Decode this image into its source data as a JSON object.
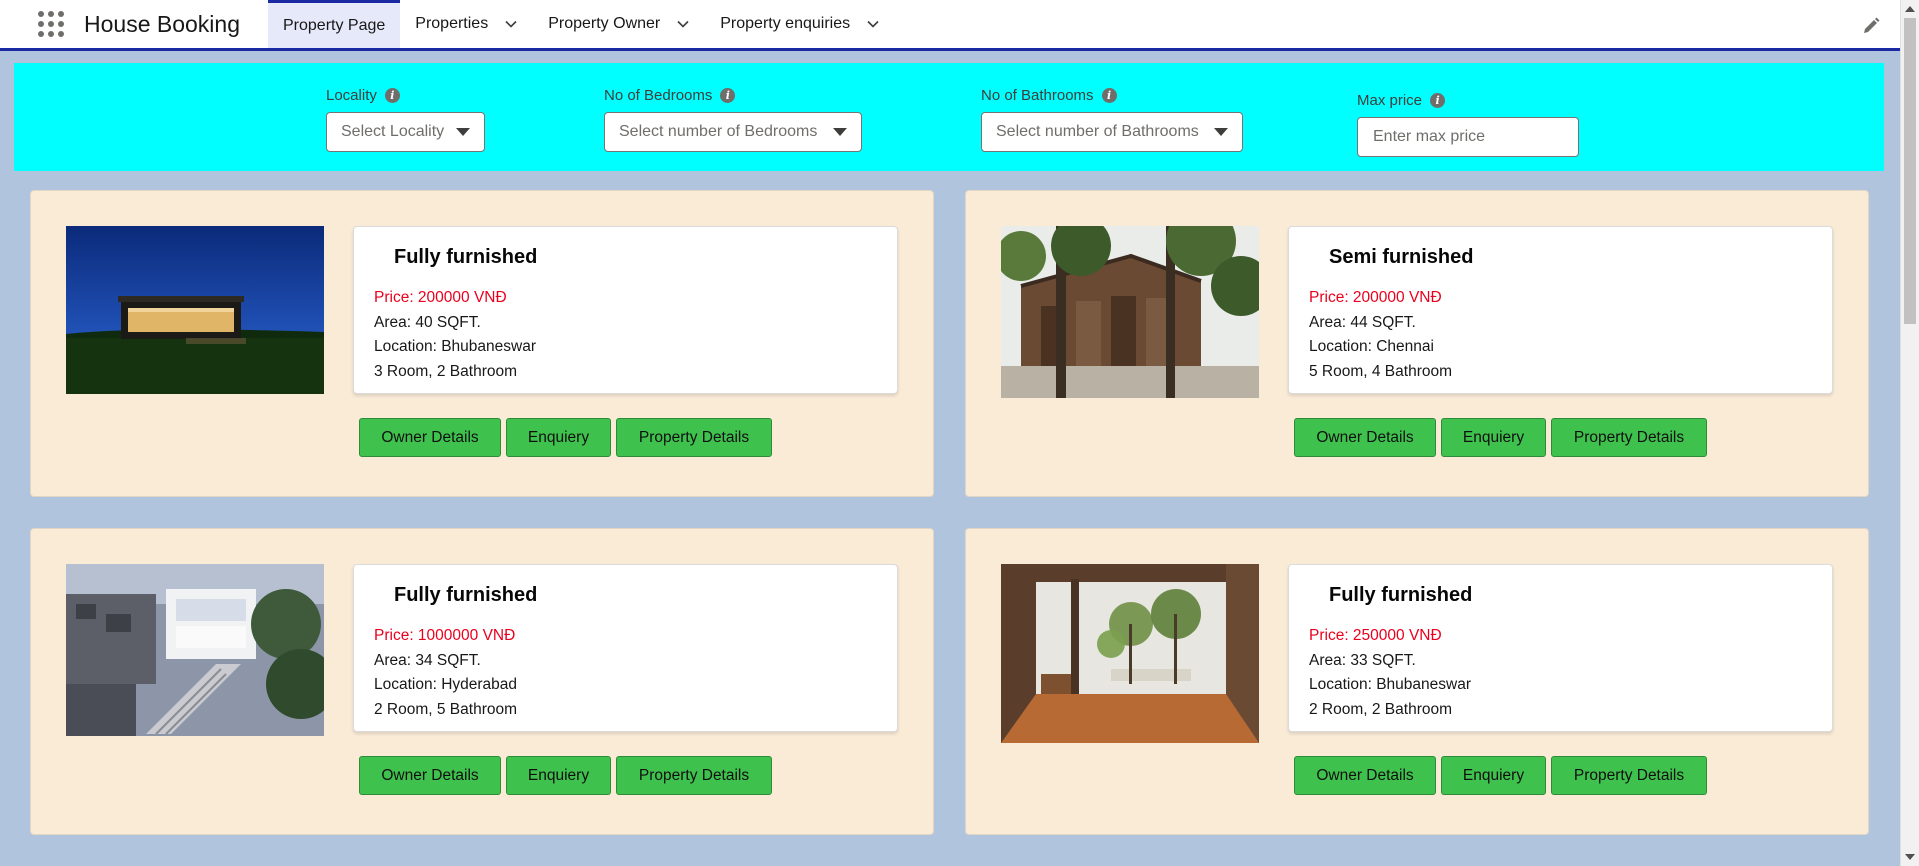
{
  "app": {
    "name": "House Booking"
  },
  "nav": {
    "tabs": [
      {
        "label": "Property Page",
        "active": true,
        "has_menu": false
      },
      {
        "label": "Properties",
        "active": false,
        "has_menu": true
      },
      {
        "label": "Property Owner",
        "active": false,
        "has_menu": true
      },
      {
        "label": "Property enquiries",
        "active": false,
        "has_menu": true
      }
    ]
  },
  "filters": {
    "locality": {
      "label": "Locality",
      "placeholder": "Select Locality"
    },
    "bedrooms": {
      "label": "No of Bedrooms",
      "placeholder": "Select number of Bedrooms"
    },
    "bathrooms": {
      "label": "No of Bathrooms",
      "placeholder": "Select number of Bathrooms"
    },
    "max_price": {
      "label": "Max price",
      "placeholder": "Enter max price"
    }
  },
  "buttons": {
    "owner": "Owner Details",
    "enquiry": "Enquiery",
    "property": "Property Details"
  },
  "properties": [
    {
      "furnishing": "Fully furnished",
      "price": "Price: 200000 VNĐ",
      "area": "Area: 40 SQFT.",
      "location": "Location: Bhubaneswar",
      "rooms": "3 Room, 2 Bathroom",
      "image": "modern-house-night"
    },
    {
      "furnishing": "Semi furnished",
      "price": "Price: 200000 VNĐ",
      "area": "Area: 44 SQFT.",
      "location": "Location: Chennai",
      "rooms": "5 Room, 4 Bathroom",
      "image": "wooden-cabin-forest"
    },
    {
      "furnishing": "Fully furnished",
      "price": "Price: 1000000 VNĐ",
      "area": "Area: 34 SQFT.",
      "location": "Location: Hyderabad",
      "rooms": "2 Room, 5 Bathroom",
      "image": "urban-glass-house"
    },
    {
      "furnishing": "Fully furnished",
      "price": "Price: 250000 VNĐ",
      "area": "Area: 33 SQFT.",
      "location": "Location: Bhubaneswar",
      "rooms": "2 Room, 2 Bathroom",
      "image": "interior-courtyard"
    }
  ],
  "colors": {
    "page_bg": "#b0c4de",
    "filter_bg": "#00ffff",
    "card_bg": "#faebd7",
    "button_bg": "#3fc24d",
    "price_text": "#ea001e",
    "nav_accent": "#1b2aa3"
  }
}
